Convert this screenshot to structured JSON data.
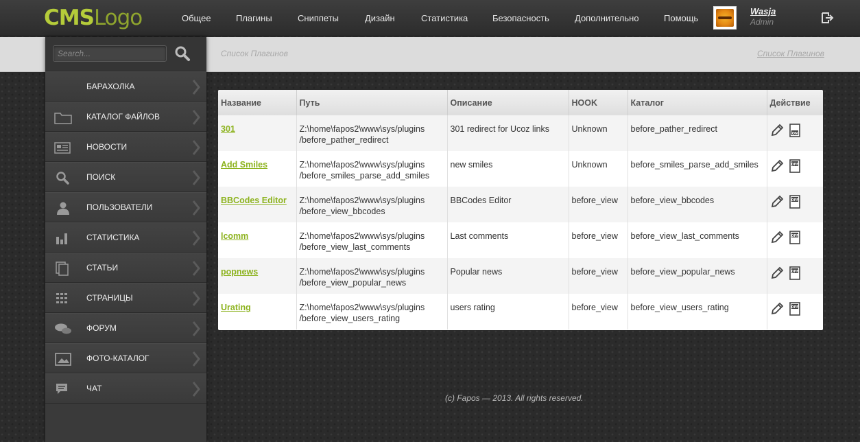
{
  "header": {
    "logo_a": "CMS",
    "logo_b": "Logo",
    "nav": [
      "Общее",
      "Плагины",
      "Сниппеты",
      "Дизайн",
      "Статистика",
      "Безопасность",
      "Дополнительно",
      "Помощь"
    ],
    "user": {
      "name": "Wasja",
      "role": "Admin"
    }
  },
  "breadcrumb": {
    "left": "Список Плагинов",
    "right": "Список Плагинов"
  },
  "sidebar": {
    "search_placeholder": "Search...",
    "items": [
      {
        "label": "БАРАХОЛКА",
        "icon": "none"
      },
      {
        "label": "КАТАЛОГ ФАЙЛОВ",
        "icon": "folder-icon"
      },
      {
        "label": "НОВОСТИ",
        "icon": "news-icon"
      },
      {
        "label": "ПОИСК",
        "icon": "search-icon"
      },
      {
        "label": "ПОЛЬЗОВАТЕЛИ",
        "icon": "user-icon"
      },
      {
        "label": "СТАТИСТИКА",
        "icon": "bar-chart-icon"
      },
      {
        "label": "СТАТЬИ",
        "icon": "documents-icon"
      },
      {
        "label": "СТРАНИЦЫ",
        "icon": "grid-icon"
      },
      {
        "label": "ФОРУМ",
        "icon": "chat-bubbles-icon"
      },
      {
        "label": "ФОТО-КАТАЛОГ",
        "icon": "image-icon"
      },
      {
        "label": "ЧАТ",
        "icon": "message-icon"
      }
    ]
  },
  "table": {
    "columns": [
      "Название",
      "Путь",
      "Описание",
      "HOOK",
      "Каталог",
      "Действие"
    ],
    "rows": [
      {
        "name": "301",
        "path1": "Z:\\home\\fapos2\\www\\sys/plugins",
        "path2": "/before_pather_redirect",
        "desc": "301 redirect for Ucoz links",
        "hook": "Unknown",
        "catalog": "before_pather_redirect",
        "toggle": "ON"
      },
      {
        "name": "Add Smiles",
        "path1": "Z:\\home\\fapos2\\www\\sys/plugins",
        "path2": "/before_smiles_parse_add_smiles",
        "desc": "new smiles",
        "hook": "Unknown",
        "catalog": "before_smiles_parse_add_smiles",
        "toggle": "OFF"
      },
      {
        "name": "BBCodes Editor",
        "path1": "Z:\\home\\fapos2\\www\\sys/plugins",
        "path2": "/before_view_bbcodes",
        "desc": "BBCodes Editor",
        "hook": "before_view",
        "catalog": "before_view_bbcodes",
        "toggle": "OFF"
      },
      {
        "name": "lcomm",
        "path1": "Z:\\home\\fapos2\\www\\sys/plugins",
        "path2": "/before_view_last_comments",
        "desc": "Last comments",
        "hook": "before_view",
        "catalog": "before_view_last_comments",
        "toggle": "OFF"
      },
      {
        "name": "popnews",
        "path1": "Z:\\home\\fapos2\\www\\sys/plugins",
        "path2": "/before_view_popular_news",
        "desc": "Popular news",
        "hook": "before_view",
        "catalog": "before_view_popular_news",
        "toggle": "OFF"
      },
      {
        "name": "Urating",
        "path1": "Z:\\home\\fapos2\\www\\sys/plugins",
        "path2": "/before_view_users_rating",
        "desc": "users rating",
        "hook": "before_view",
        "catalog": "before_view_users_rating",
        "toggle": "OFF"
      }
    ]
  },
  "footer": "(c) Fapos — 2013. All rights reserved.",
  "colors": {
    "accent": "#8db31f",
    "logo": "#b5cc3a"
  }
}
